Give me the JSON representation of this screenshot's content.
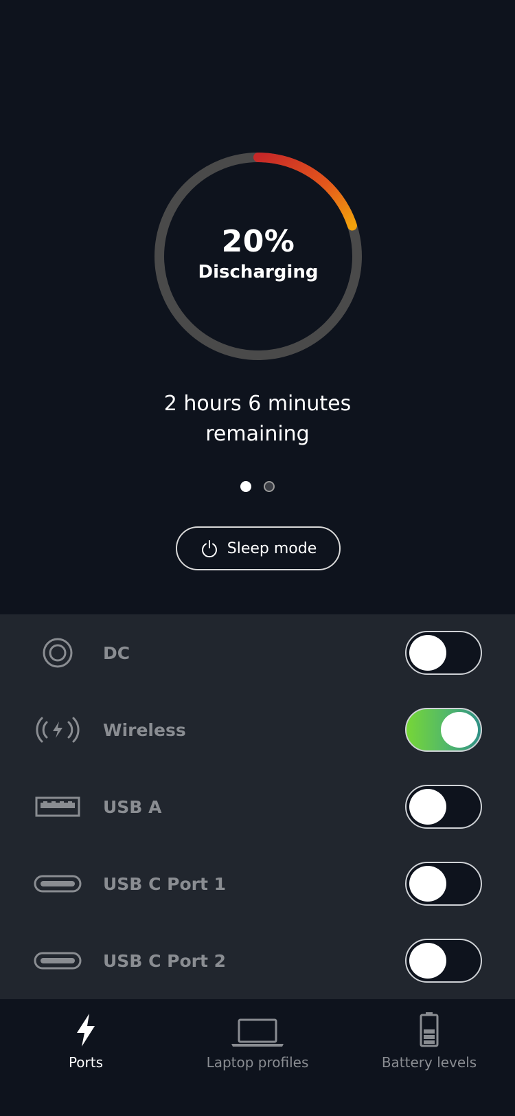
{
  "battery": {
    "percent_text": "20%",
    "percent_value": 0.2,
    "status": "Discharging",
    "remaining_line1": "2 hours 6 minutes",
    "remaining_line2": "remaining",
    "colors": {
      "track": "#4a4a4a",
      "arc_start": "#c62828",
      "arc_end": "#f2a20c"
    }
  },
  "pager": {
    "count": 2,
    "active_index": 0
  },
  "sleep_button": {
    "label": "Sleep mode",
    "icon": "power-icon"
  },
  "ports": [
    {
      "label": "DC",
      "icon": "dc-port-icon",
      "enabled": false
    },
    {
      "label": "Wireless",
      "icon": "wireless-charging-icon",
      "enabled": true
    },
    {
      "label": "USB A",
      "icon": "usb-a-port-icon",
      "enabled": false
    },
    {
      "label": "USB C Port 1",
      "icon": "usb-c-port-icon",
      "enabled": false
    },
    {
      "label": "USB C Port 2",
      "icon": "usb-c-port-icon",
      "enabled": false
    }
  ],
  "tabs": [
    {
      "label": "Ports",
      "icon": "lightning-bolt-icon",
      "active": true
    },
    {
      "label": "Laptop profiles",
      "icon": "laptop-icon",
      "active": false
    },
    {
      "label": "Battery levels",
      "icon": "battery-icon",
      "active": false
    }
  ],
  "theme": {
    "background": "#0e131d",
    "panel": "#21262e",
    "toggle_on": "#52b86a"
  }
}
